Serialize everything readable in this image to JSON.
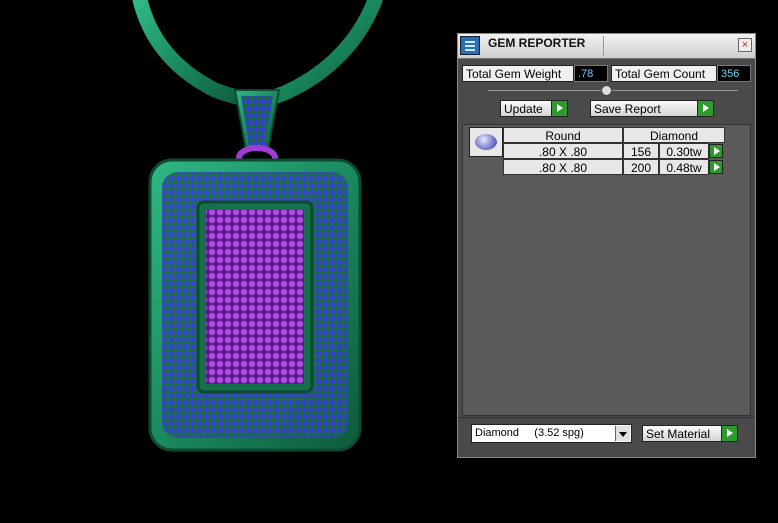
{
  "window": {
    "title": "GEM REPORTER",
    "icon": "gem-reporter-icon",
    "close": "×"
  },
  "totals": {
    "weight_label": "Total Gem Weight",
    "weight_value": ".78",
    "count_label": "Total Gem Count",
    "count_value": "356"
  },
  "actions": {
    "update_label": "Update",
    "save_label": "Save Report"
  },
  "table": {
    "headers": {
      "shape": "Round",
      "stone": "Diamond"
    },
    "rows": [
      {
        "size": ".80 X .80",
        "count": "156",
        "weight": "0.30tw"
      },
      {
        "size": ".80 X .80",
        "count": "200",
        "weight": "0.48tw"
      }
    ]
  },
  "material": {
    "selected": "Diamond     (3.52 spg)",
    "set_label": "Set Material"
  },
  "colors": {
    "metal": "#1f9a6a",
    "pave_blue": "#3a3ad0",
    "pave_purple": "#9a3ad8",
    "accent_green": "#2e9a2e"
  }
}
